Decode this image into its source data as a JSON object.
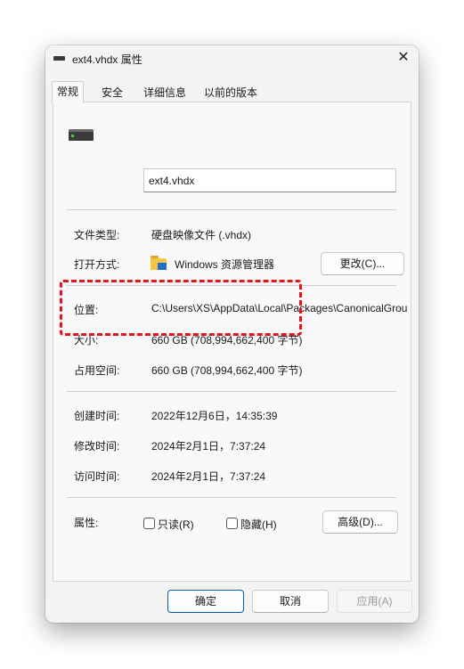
{
  "window": {
    "title": "ext4.vhdx 属性",
    "close_label": "✕"
  },
  "tabs": [
    "常规",
    "安全",
    "详细信息",
    "以前的版本"
  ],
  "general": {
    "file_name": "ext4.vhdx",
    "file_type_label": "文件类型:",
    "file_type_value": "硬盘映像文件 (.vhdx)",
    "opens_with_label": "打开方式:",
    "opens_with_value": "Windows 资源管理器",
    "change_button": "更改(C)...",
    "location_label": "位置:",
    "location_value": "C:\\Users\\XS\\AppData\\Local\\Packages\\CanonicalGroupLimited",
    "size_label": "大小:",
    "size_value": "660 GB (708,994,662,400 字节)",
    "size_on_disk_label": "占用空间:",
    "size_on_disk_value": "660 GB (708,994,662,400 字节)",
    "created_label": "创建时间:",
    "created_value": "2022年12月6日，14:35:39",
    "modified_label": "修改时间:",
    "modified_value": "2024年2月1日，7:37:24",
    "accessed_label": "访问时间:",
    "accessed_value": "2024年2月1日，7:37:24",
    "attributes_label": "属性:",
    "readonly_label": "只读(R)",
    "readonly_checked": false,
    "hidden_label": "隐藏(H)",
    "hidden_checked": false,
    "advanced_button": "高级(D)..."
  },
  "footer": {
    "ok": "确定",
    "cancel": "取消",
    "apply": "应用(A)"
  },
  "colors": {
    "highlight": "#e3141c",
    "primary_border": "#005fb8",
    "window_bg": "#f3f3f3"
  },
  "icons": {
    "title": "drive-icon",
    "file": "hard-drive-icon",
    "app": "folder-icon"
  }
}
